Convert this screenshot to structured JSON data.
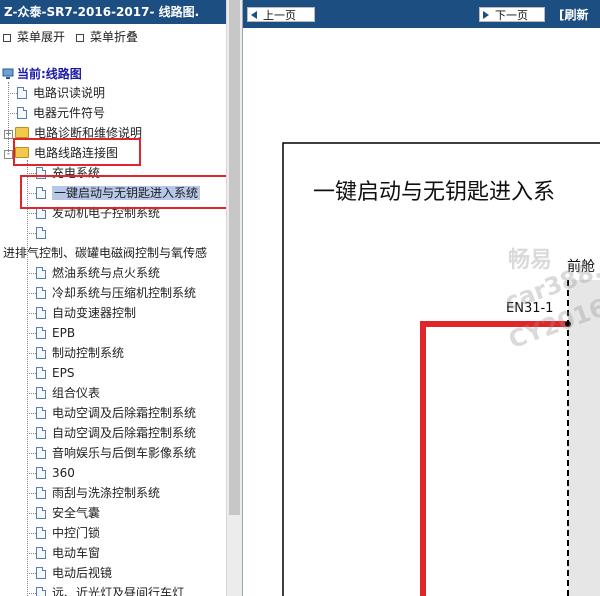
{
  "window": {
    "title": "Z-众泰-SR7-2016-2017- 线路图."
  },
  "menu": {
    "expand": "菜单展开",
    "collapse": "菜单折叠"
  },
  "tree": {
    "current": "当前:线路图",
    "items": [
      {
        "label": "电路识读说明",
        "level": 1,
        "type": "doc"
      },
      {
        "label": "电器元件符号",
        "level": 1,
        "type": "doc"
      },
      {
        "label": "电路诊断和维修说明",
        "level": 1,
        "type": "folder",
        "toggle": "+"
      },
      {
        "label": "电路线路连接图",
        "level": 1,
        "type": "folder",
        "toggle": "-",
        "highlighted": true
      },
      {
        "label": "充电系统",
        "level": 2,
        "type": "doc"
      },
      {
        "label": "一键启动与无钥匙进入系统",
        "level": 2,
        "type": "doc",
        "selected": true,
        "highlighted": true
      },
      {
        "label": "发动机电子控制系统",
        "level": 2,
        "type": "doc"
      },
      {
        "label": "",
        "level": 2,
        "type": "doc"
      },
      {
        "label": "进排气控制、碳罐电磁阀控制与氧传感",
        "level": 0,
        "type": "text"
      },
      {
        "label": "燃油系统与点火系统",
        "level": 2,
        "type": "doc"
      },
      {
        "label": "冷却系统与压缩机控制系统",
        "level": 2,
        "type": "doc"
      },
      {
        "label": "自动变速器控制",
        "level": 2,
        "type": "doc"
      },
      {
        "label": "EPB",
        "level": 2,
        "type": "doc"
      },
      {
        "label": "制动控制系统",
        "level": 2,
        "type": "doc"
      },
      {
        "label": "EPS",
        "level": 2,
        "type": "doc"
      },
      {
        "label": "组合仪表",
        "level": 2,
        "type": "doc"
      },
      {
        "label": "电动空调及后除霜控制系统",
        "level": 2,
        "type": "doc"
      },
      {
        "label": "自动空调及后除霜控制系统",
        "level": 2,
        "type": "doc"
      },
      {
        "label": "音响娱乐与后倒车影像系统",
        "level": 2,
        "type": "doc"
      },
      {
        "label": "360",
        "level": 2,
        "type": "doc"
      },
      {
        "label": "雨刮与洗涤控制系统",
        "level": 2,
        "type": "doc"
      },
      {
        "label": "安全气囊",
        "level": 2,
        "type": "doc"
      },
      {
        "label": "中控门锁",
        "level": 2,
        "type": "doc"
      },
      {
        "label": "电动车窗",
        "level": 2,
        "type": "doc"
      },
      {
        "label": "电动后视镜",
        "level": 2,
        "type": "doc"
      },
      {
        "label": "远、近光灯及昼间行车灯",
        "level": 2,
        "type": "doc"
      }
    ]
  },
  "viewer": {
    "prev_label": "上一页",
    "next_label": "下一页",
    "refresh_label": "[刷新",
    "diagram_title": "一键启动与无钥匙进入系",
    "front_label": "前舱",
    "connector_label": "EN31-1",
    "watermark_1": "畅易",
    "watermark_2": "car388.co",
    "watermark_3": "CY2016"
  },
  "colors": {
    "titlebar": "#1c4e82",
    "wire_red": "#e0262a",
    "highlight_box": "#e0262a",
    "selection": "#b6c7e8",
    "tree_link": "#1a1aa6"
  }
}
